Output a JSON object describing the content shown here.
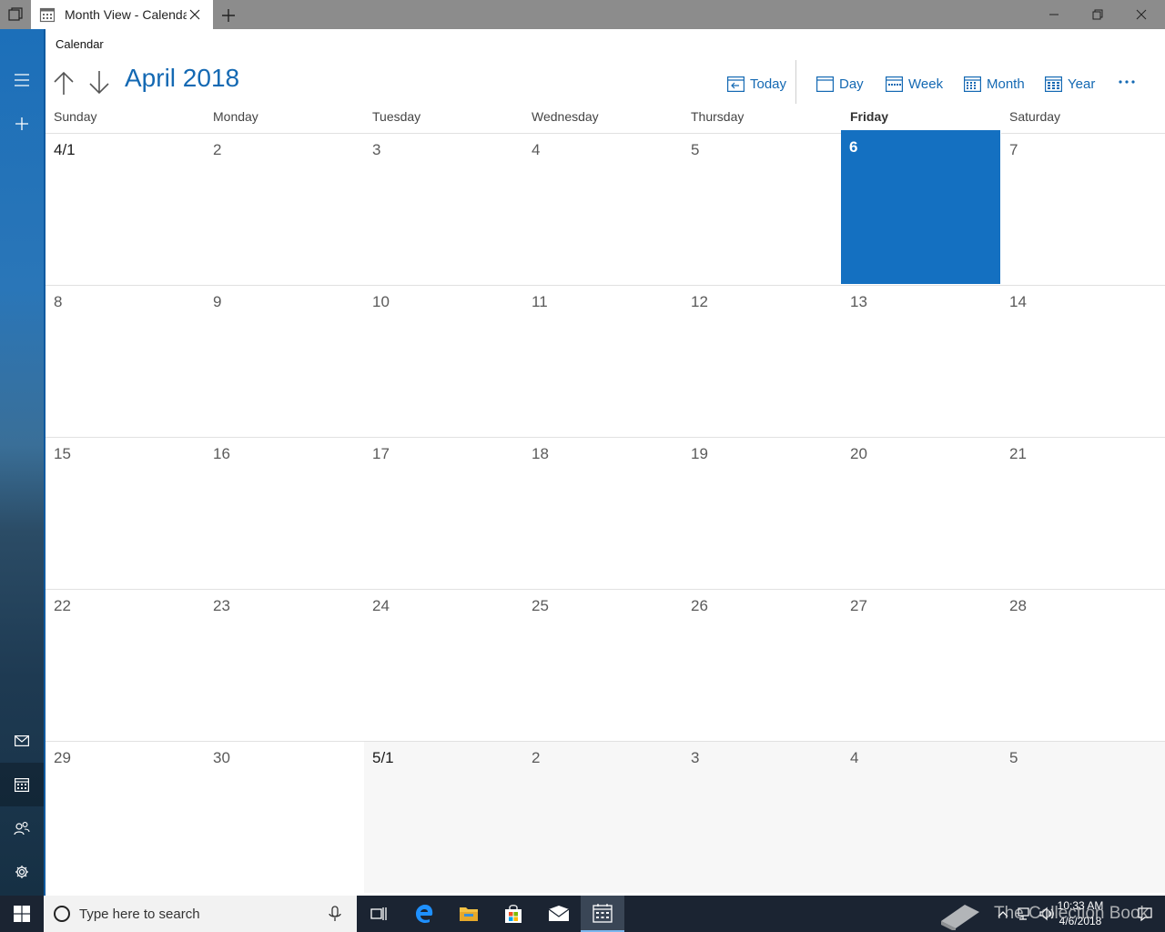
{
  "window": {
    "tab_title": "Month View - Calendar"
  },
  "app": {
    "title": "Calendar",
    "month_title": "April 2018"
  },
  "toolbar": {
    "today": "Today",
    "day": "Day",
    "week": "Week",
    "month": "Month",
    "year": "Year"
  },
  "weekdays": [
    "Sunday",
    "Monday",
    "Tuesday",
    "Wednesday",
    "Thursday",
    "Friday",
    "Saturday"
  ],
  "today_weekday_index": 5,
  "weeks": [
    [
      "4/1",
      "2",
      "3",
      "4",
      "5",
      "6",
      "7"
    ],
    [
      "8",
      "9",
      "10",
      "11",
      "12",
      "13",
      "14"
    ],
    [
      "15",
      "16",
      "17",
      "18",
      "19",
      "20",
      "21"
    ],
    [
      "22",
      "23",
      "24",
      "25",
      "26",
      "27",
      "28"
    ],
    [
      "29",
      "30",
      "5/1",
      "2",
      "3",
      "4",
      "5"
    ]
  ],
  "taskbar": {
    "search_placeholder": "Type here to search",
    "time": "10:33 AM",
    "date": "4/6/2018",
    "watermark": "The Collection Book"
  },
  "colors": {
    "accent": "#1469b3",
    "today_cell": "#1470c1",
    "taskbar": "#1b2432"
  }
}
